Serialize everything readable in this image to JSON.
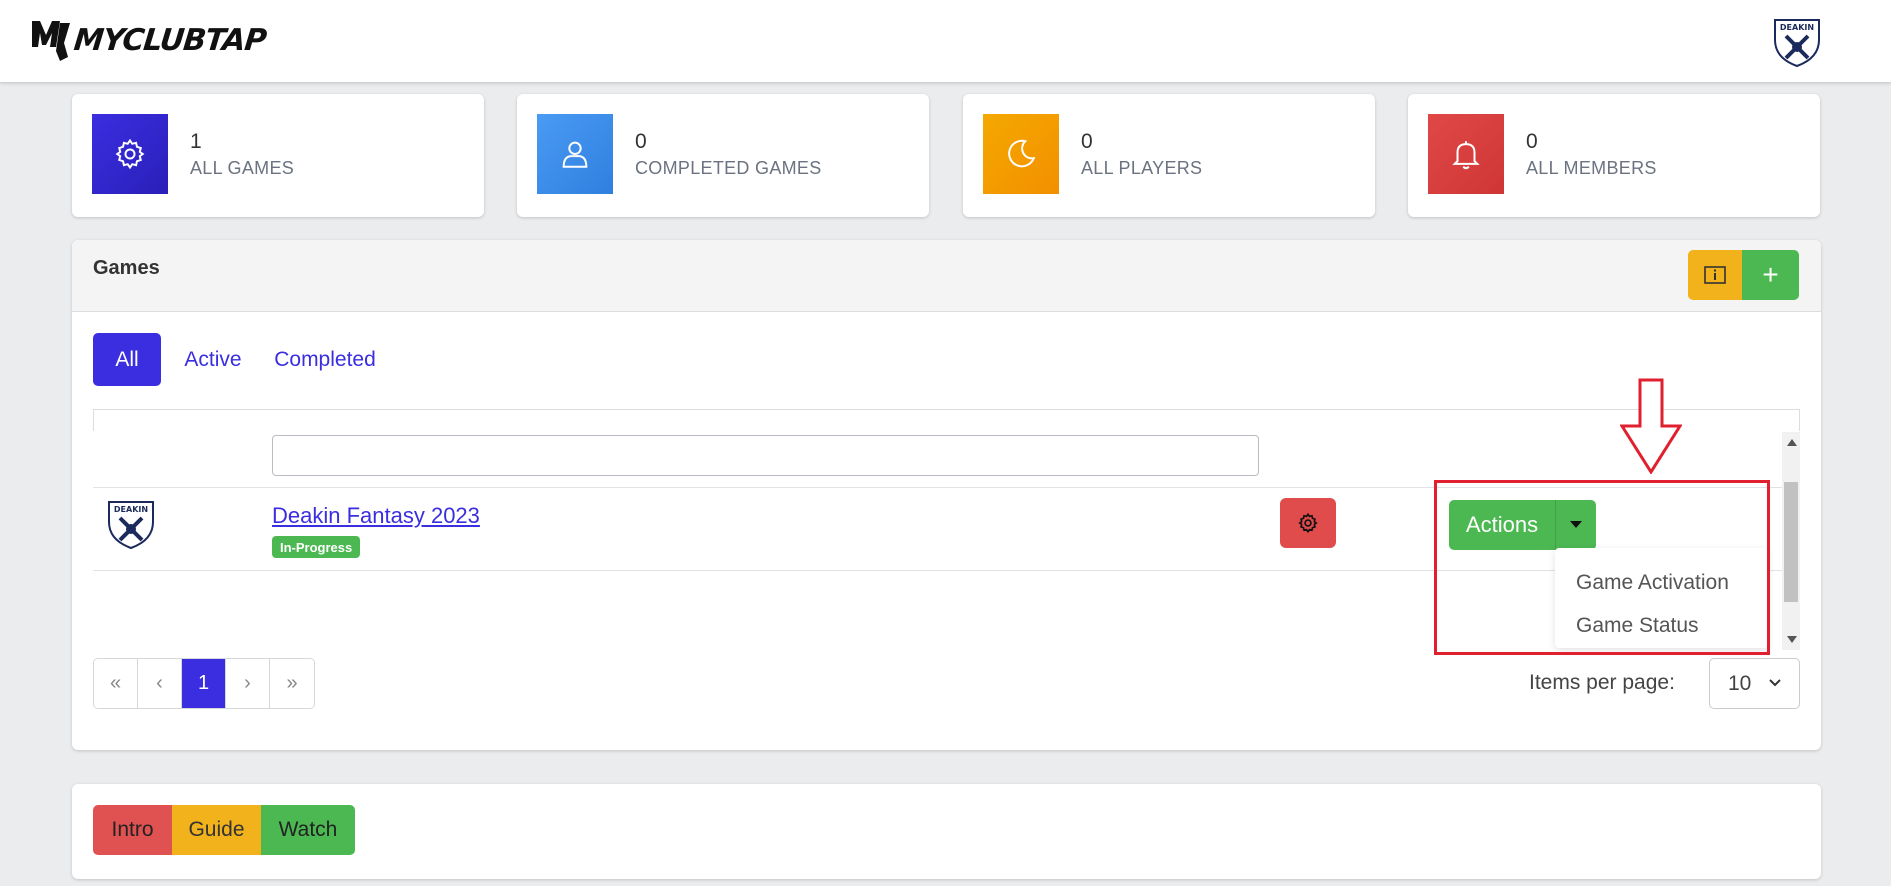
{
  "header": {
    "logo_text": "MYCLUBTAP",
    "club_avatar_text": "DEAKIN"
  },
  "stats": [
    {
      "value": "1",
      "label": "ALL GAMES",
      "icon": "gear-icon",
      "color": "#3a2ee0"
    },
    {
      "value": "0",
      "label": "COMPLETED GAMES",
      "icon": "user-icon",
      "color": "#3d8ff0"
    },
    {
      "value": "0",
      "label": "ALL PLAYERS",
      "icon": "moon-icon",
      "color": "#f2a500"
    },
    {
      "value": "0",
      "label": "ALL MEMBERS",
      "icon": "bell-icon",
      "color": "#e04545"
    }
  ],
  "games_panel": {
    "title": "Games",
    "info_icon": "info-icon",
    "add_label": "+",
    "tabs": [
      "All",
      "Active",
      "Completed"
    ],
    "active_tab": "All",
    "filter": {
      "value": "",
      "placeholder": ""
    },
    "rows": [
      {
        "club_logo_text": "DEAKIN",
        "name": "Deakin Fantasy 2023",
        "status": "In-Progress",
        "settings_icon": "gear-icon",
        "actions_label": "Actions",
        "dropdown": [
          "Game Activation",
          "Game Status"
        ]
      }
    ],
    "pagination": {
      "first": "«",
      "prev": "‹",
      "current": "1",
      "next": "›",
      "last": "»"
    },
    "items_per_page_label": "Items per page:",
    "items_per_page_value": "10"
  },
  "help_buttons": [
    {
      "label": "Intro",
      "color": "#e05252"
    },
    {
      "label": "Guide",
      "color": "#f2b21c"
    },
    {
      "label": "Watch",
      "color": "#4cb852"
    }
  ],
  "colors": {
    "primary": "#3a2ee0",
    "success": "#4cb852",
    "warning": "#f2b21c",
    "danger": "#e04b4b",
    "annotation": "#e0202e"
  }
}
